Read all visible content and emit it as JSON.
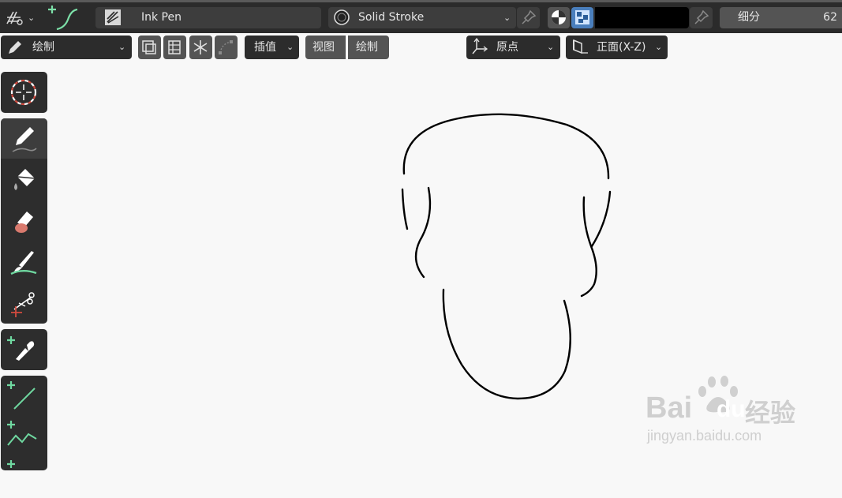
{
  "header": {
    "brush_name": "Ink Pen",
    "material_name": "Solid Stroke",
    "subdivision_label": "细分",
    "subdivision_value": "62",
    "color_swatch": "#000000"
  },
  "toolbar": {
    "mode_label": "绘制",
    "interpolate_label": "插值",
    "view_label": "视图",
    "draw_label": "绘制",
    "origin_label": "原点",
    "plane_label": "正面(X-Z)"
  },
  "tools": [
    {
      "name": "cursor-tool",
      "icon": "crosshair-icon"
    },
    {
      "name": "draw-tool",
      "icon": "pencil-icon"
    },
    {
      "name": "fill-tool",
      "icon": "bucket-icon"
    },
    {
      "name": "erase-tool",
      "icon": "eraser-icon"
    },
    {
      "name": "tint-tool",
      "icon": "brush-icon"
    },
    {
      "name": "cutter-tool",
      "icon": "scissors-icon"
    },
    {
      "name": "eyedropper-tool",
      "icon": "eyedropper-icon"
    },
    {
      "name": "line-tool",
      "icon": "line-icon"
    },
    {
      "name": "polyline-tool",
      "icon": "polyline-icon"
    }
  ],
  "watermark": {
    "brand_latin": "Bai",
    "brand_du": "du",
    "brand_cn": "经验",
    "url": "jingyan.baidu.com"
  },
  "colors": {
    "accent_green": "#6fd8a0",
    "header_bg": "#2b2b2b",
    "viewport_bg": "#f8f8f8",
    "stroke": "#000000"
  }
}
